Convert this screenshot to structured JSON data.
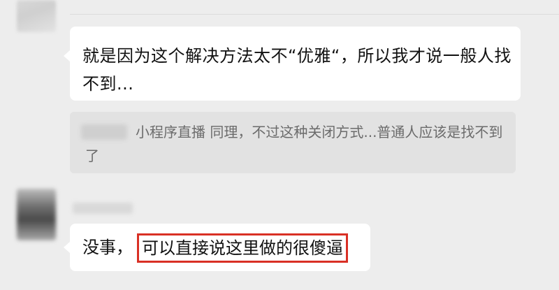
{
  "messages": [
    {
      "type": "text",
      "text": "就是因为这个解决方法太不“优雅“，所以我才说一般人找不到..."
    },
    {
      "type": "quote",
      "source": "小程序直播",
      "text": "同理，不过这种关闭方式...普通人应该是找不到了"
    },
    {
      "type": "text",
      "prefix": "没事，",
      "highlighted": "可以直接说这里做的很傻逼",
      "highlight_color": "#d93025"
    }
  ],
  "colors": {
    "background": "#ededed",
    "bubble": "#ffffff",
    "quote_background": "#e2e2e2",
    "quote_text": "#6b6b6b"
  }
}
